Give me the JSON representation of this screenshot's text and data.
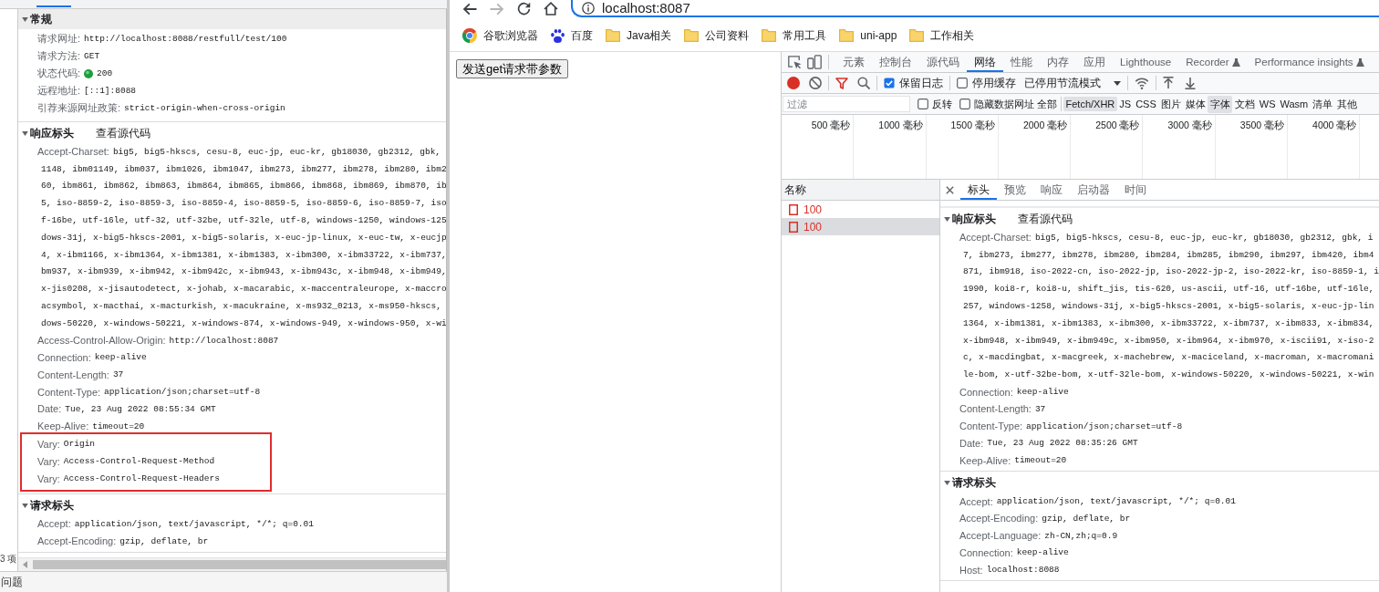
{
  "left_devtools": {
    "sections": [
      {
        "kind": "general",
        "title": "常规",
        "expanded": true,
        "rows": [
          {
            "kind": "text",
            "label": "请求网址:",
            "value": "http://localhost:8088/restfull/test/100"
          },
          {
            "kind": "text",
            "label": "请求方法:",
            "value": "GET"
          },
          {
            "kind": "status",
            "label": "状态代码:",
            "value": "200"
          },
          {
            "kind": "text",
            "label": "远程地址:",
            "value": "[::1]:8088"
          },
          {
            "kind": "text",
            "label": "引荐来源网址政策:",
            "value": "strict-origin-when-cross-origin"
          }
        ]
      },
      {
        "kind": "headers",
        "title": "响应标头",
        "expanded": true,
        "link": "查看源代码",
        "headers": [
          {
            "name": "Accept-Charset:",
            "lines": [
              "big5, big5-hkscs, cesu-8, euc-jp, euc-kr, gb18030, gb2312, gbk,",
              "1148, ibm01149, ibm037, ibm1026, ibm1047, ibm273, ibm277, ibm278, ibm280, ibm2",
              "60, ibm861, ibm862, ibm863, ibm864, ibm865, ibm866, ibm868, ibm869, ibm870, ib",
              "5, iso-8859-2, iso-8859-3, iso-8859-4, iso-8859-5, iso-8859-6, iso-8859-7, iso",
              "f-16be, utf-16le, utf-32, utf-32be, utf-32le, utf-8, windows-1250, windows-125",
              "dows-31j, x-big5-hkscs-2001, x-big5-solaris, x-euc-jp-linux, x-euc-tw, x-eucjp",
              "4, x-ibm1166, x-ibm1364, x-ibm1381, x-ibm1383, x-ibm300, x-ibm33722, x-ibm737,",
              "bm937, x-ibm939, x-ibm942, x-ibm942c, x-ibm943, x-ibm943c, x-ibm948, x-ibm949,",
              "x-jis0208, x-jisautodetect, x-johab, x-macarabic, x-maccentraleurope, x-maccro",
              "acsymbol, x-macthai, x-macturkish, x-macukraine, x-ms932_0213, x-ms950-hkscs,",
              "dows-50220, x-windows-50221, x-windows-874, x-windows-949, x-windows-950, x-wi"
            ],
            "highlighted": false
          },
          {
            "name": "Access-Control-Allow-Origin:",
            "lines": [
              "http://localhost:8087"
            ],
            "highlighted": false
          },
          {
            "name": "Connection:",
            "lines": [
              "keep-alive"
            ],
            "highlighted": false
          },
          {
            "name": "Content-Length:",
            "lines": [
              "37"
            ],
            "highlighted": false
          },
          {
            "name": "Content-Type:",
            "lines": [
              "application/json;charset=utf-8"
            ],
            "highlighted": false
          },
          {
            "name": "Date:",
            "lines": [
              "Tue, 23 Aug 2022 08:55:34 GMT"
            ],
            "highlighted": false
          },
          {
            "name": "Keep-Alive:",
            "lines": [
              "timeout=20"
            ],
            "highlighted": false
          },
          {
            "name": "Vary:",
            "lines": [
              "Origin"
            ],
            "highlighted": true
          },
          {
            "name": "Vary:",
            "lines": [
              "Access-Control-Request-Method"
            ],
            "highlighted": true
          },
          {
            "name": "Vary:",
            "lines": [
              "Access-Control-Request-Headers"
            ],
            "highlighted": true
          }
        ]
      },
      {
        "kind": "headers",
        "title": "请求标头",
        "expanded": true,
        "headers": [
          {
            "name": "Accept:",
            "lines": [
              "application/json, text/javascript, */*; q=0.01"
            ]
          },
          {
            "name": "Accept-Encoding:",
            "lines": [
              "gzip, deflate, br"
            ]
          }
        ]
      }
    ],
    "request_count": "3 项",
    "drawer_tab": "问题"
  },
  "browser": {
    "nav": {
      "back_enabled": true,
      "forward_enabled": false,
      "url": "localhost:8087"
    },
    "bookmarks": [
      {
        "kind": "logo",
        "label": "谷歌浏览器"
      },
      {
        "kind": "paw",
        "label": "百度"
      },
      {
        "kind": "folder",
        "label": "Java相关"
      },
      {
        "kind": "folder",
        "label": "公司资料"
      },
      {
        "kind": "folder",
        "label": "常用工具"
      },
      {
        "kind": "folder",
        "label": "uni-app"
      },
      {
        "kind": "folder",
        "label": "工作相关"
      }
    ],
    "page": {
      "button": "发送get请求带参数"
    },
    "devtools": {
      "tabs": [
        {
          "label": "元素",
          "selected": false,
          "experimental": false
        },
        {
          "label": "控制台",
          "selected": false,
          "experimental": false
        },
        {
          "label": "源代码",
          "selected": false,
          "experimental": false
        },
        {
          "label": "网络",
          "selected": true,
          "experimental": false
        },
        {
          "label": "性能",
          "selected": false,
          "experimental": false
        },
        {
          "label": "内存",
          "selected": false,
          "experimental": false
        },
        {
          "label": "应用",
          "selected": false,
          "experimental": false
        },
        {
          "label": "Lighthouse",
          "selected": false,
          "experimental": false
        },
        {
          "label": "Recorder",
          "selected": false,
          "experimental": true
        },
        {
          "label": "Performance insights",
          "selected": false,
          "experimental": true
        }
      ],
      "toolbar": {
        "recording": true,
        "filter_open": true,
        "checkboxes": [
          {
            "label": "保留日志",
            "checked": true
          },
          {
            "label": "停用缓存",
            "checked": false
          }
        ],
        "throttling": "已停用节流模式"
      },
      "filter_bar": {
        "placeholder": "过滤",
        "checkboxes": [
          {
            "label": "反转",
            "checked": false
          },
          {
            "label": "隐藏数据网址",
            "checked": false
          }
        ],
        "types": [
          {
            "label": "全部",
            "selected": false
          },
          {
            "label": "Fetch/XHR",
            "selected": true
          },
          {
            "label": "JS",
            "selected": false
          },
          {
            "label": "CSS",
            "selected": false
          },
          {
            "label": "图片",
            "selected": false
          },
          {
            "label": "媒体",
            "selected": false
          },
          {
            "label": "字体",
            "selected": true
          },
          {
            "label": "文档",
            "selected": false
          },
          {
            "label": "WS",
            "selected": false
          },
          {
            "label": "Wasm",
            "selected": false
          },
          {
            "label": "清单",
            "selected": false
          },
          {
            "label": "其他",
            "selected": false
          }
        ]
      },
      "overview": {
        "ticks": [
          "500 毫秒",
          "1000 毫秒",
          "1500 毫秒",
          "2000 毫秒",
          "2500 毫秒",
          "3000 毫秒",
          "3500 毫秒",
          "4000 毫秒"
        ]
      },
      "requests": {
        "column": "名称",
        "rows": [
          {
            "name": "100",
            "failed": true,
            "selected": false
          },
          {
            "name": "100",
            "failed": true,
            "selected": true
          }
        ]
      },
      "detail": {
        "tabs": [
          {
            "label": "标头",
            "selected": true
          },
          {
            "label": "预览",
            "selected": false
          },
          {
            "label": "响应",
            "selected": false
          },
          {
            "label": "启动器",
            "selected": false
          },
          {
            "label": "时间",
            "selected": false
          }
        ],
        "sections": [
          {
            "kind": "headers",
            "title": "响应标头",
            "expanded": true,
            "link": "查看源代码",
            "headers": [
              {
                "name": "Accept-Charset:",
                "lines": [
                  "big5, big5-hkscs, cesu-8, euc-jp, euc-kr, gb18030, gb2312, gbk, i",
                  "7, ibm273, ibm277, ibm278, ibm280, ibm284, ibm285, ibm290, ibm297, ibm420, ibm4",
                  "871, ibm918, iso-2022-cn, iso-2022-jp, iso-2022-jp-2, iso-2022-kr, iso-8859-1, i",
                  "1990, koi8-r, koi8-u, shift_jis, tis-620, us-ascii, utf-16, utf-16be, utf-16le,",
                  "257, windows-1258, windows-31j, x-big5-hkscs-2001, x-big5-solaris, x-euc-jp-lin",
                  "1364, x-ibm1381, x-ibm1383, x-ibm300, x-ibm33722, x-ibm737, x-ibm833, x-ibm834,",
                  "x-ibm948, x-ibm949, x-ibm949c, x-ibm950, x-ibm964, x-ibm970, x-iscii91, x-iso-2",
                  "c, x-macdingbat, x-macgreek, x-machebrew, x-maciceland, x-macroman, x-macromani",
                  "le-bom, x-utf-32be-bom, x-utf-32le-bom, x-windows-50220, x-windows-50221, x-win"
                ]
              },
              {
                "name": "Connection:",
                "lines": [
                  "keep-alive"
                ]
              },
              {
                "name": "Content-Length:",
                "lines": [
                  "37"
                ]
              },
              {
                "name": "Content-Type:",
                "lines": [
                  "application/json;charset=utf-8"
                ]
              },
              {
                "name": "Date:",
                "lines": [
                  "Tue, 23 Aug 2022 08:35:26 GMT"
                ]
              },
              {
                "name": "Keep-Alive:",
                "lines": [
                  "timeout=20"
                ]
              }
            ]
          },
          {
            "kind": "headers",
            "title": "请求标头",
            "expanded": true,
            "headers": [
              {
                "name": "Accept:",
                "lines": [
                  "application/json, text/javascript, */*; q=0.01"
                ]
              },
              {
                "name": "Accept-Encoding:",
                "lines": [
                  "gzip, deflate, br"
                ]
              },
              {
                "name": "Accept-Language:",
                "lines": [
                  "zh-CN,zh;q=0.9"
                ]
              },
              {
                "name": "Connection:",
                "lines": [
                  "keep-alive"
                ]
              },
              {
                "name": "Host:",
                "lines": [
                  "localhost:8088"
                ]
              }
            ]
          }
        ]
      }
    }
  }
}
